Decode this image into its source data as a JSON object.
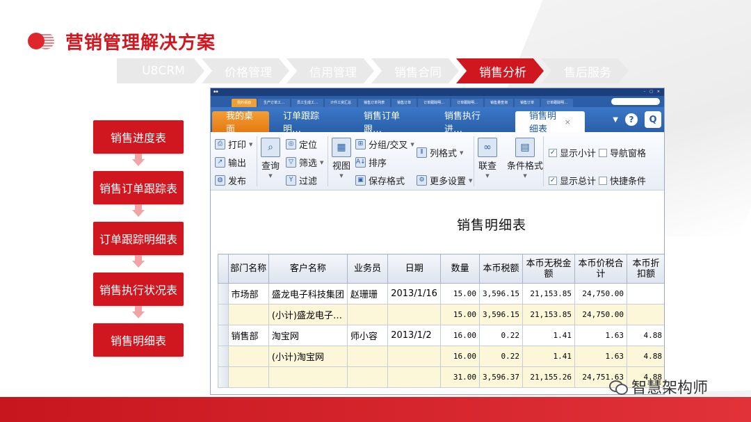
{
  "title": "营销管理解决方案",
  "nav": [
    "U8CRM",
    "价格管理",
    "信用管理",
    "销售合同",
    "销售分析",
    "售后服务"
  ],
  "nav_active": 4,
  "flow": [
    "销售进度表",
    "销售订单跟踪表",
    "订单跟踪明细表",
    "销售执行状况表",
    "销售明细表"
  ],
  "app": {
    "small_tabs": [
      "我的桌面",
      "生产订单工…",
      "员工生成工…",
      "计件工资汇总",
      "销售订单列表",
      "销售订单",
      "订单跟踪明…",
      "订单跟踪明…",
      "销售量查询",
      "销售订单",
      "订单跟踪明…"
    ],
    "tabs": {
      "desk": "我的桌面",
      "t1": "订单跟踪明…",
      "t2": "销售订单跟…",
      "t3": "销售执行进…",
      "current": "销售明细表",
      "close": "×"
    },
    "toolbar": {
      "print": "打印",
      "export": "输出",
      "publish": "发布",
      "query": "查询",
      "locate": "定位",
      "filter": "筛选",
      "filter2": "过滤",
      "view": "视图",
      "group": "分组/交叉",
      "sort": "排序",
      "save_format": "保存格式",
      "col_format": "列格式",
      "more_settings": "更多设置",
      "link": "联查",
      "cond_format": "条件格式",
      "show_subtotal": "显示小计",
      "show_total": "显示总计",
      "nav_pane": "导航窗格",
      "quick_cond": "快捷条件"
    }
  },
  "report": {
    "title": "销售明细表",
    "columns": [
      "部门名称",
      "客户名称",
      "业务员",
      "日期",
      "数量",
      "本币税额",
      "本币无税金额",
      "本币价税合计",
      "本币折扣额"
    ],
    "rows": [
      {
        "type": "data",
        "cells": [
          "市场部",
          "盛龙电子科技集团",
          "赵珊珊",
          "2013/1/16",
          "15.00",
          "3,596.15",
          "21,153.85",
          "24,750.00",
          ""
        ]
      },
      {
        "type": "sub",
        "cells": [
          "",
          "(小计)盛龙电子…",
          "",
          "",
          "15.00",
          "3,596.15",
          "21,153.85",
          "24,750.00",
          ""
        ]
      },
      {
        "type": "data",
        "cells": [
          "销售部",
          "淘宝网",
          "师小容",
          "2013/1/2",
          "16.00",
          "0.22",
          "1.41",
          "1.63",
          "4.88"
        ]
      },
      {
        "type": "sub",
        "cells": [
          "",
          "(小计)淘宝网",
          "",
          "",
          "16.00",
          "0.22",
          "1.41",
          "1.63",
          "4.88"
        ]
      },
      {
        "type": "sub",
        "cells": [
          "",
          "",
          "",
          "",
          "31.00",
          "3,596.37",
          "21,155.26",
          "24,751.63",
          "4.88"
        ]
      }
    ]
  },
  "watermark": "智慧架构师"
}
